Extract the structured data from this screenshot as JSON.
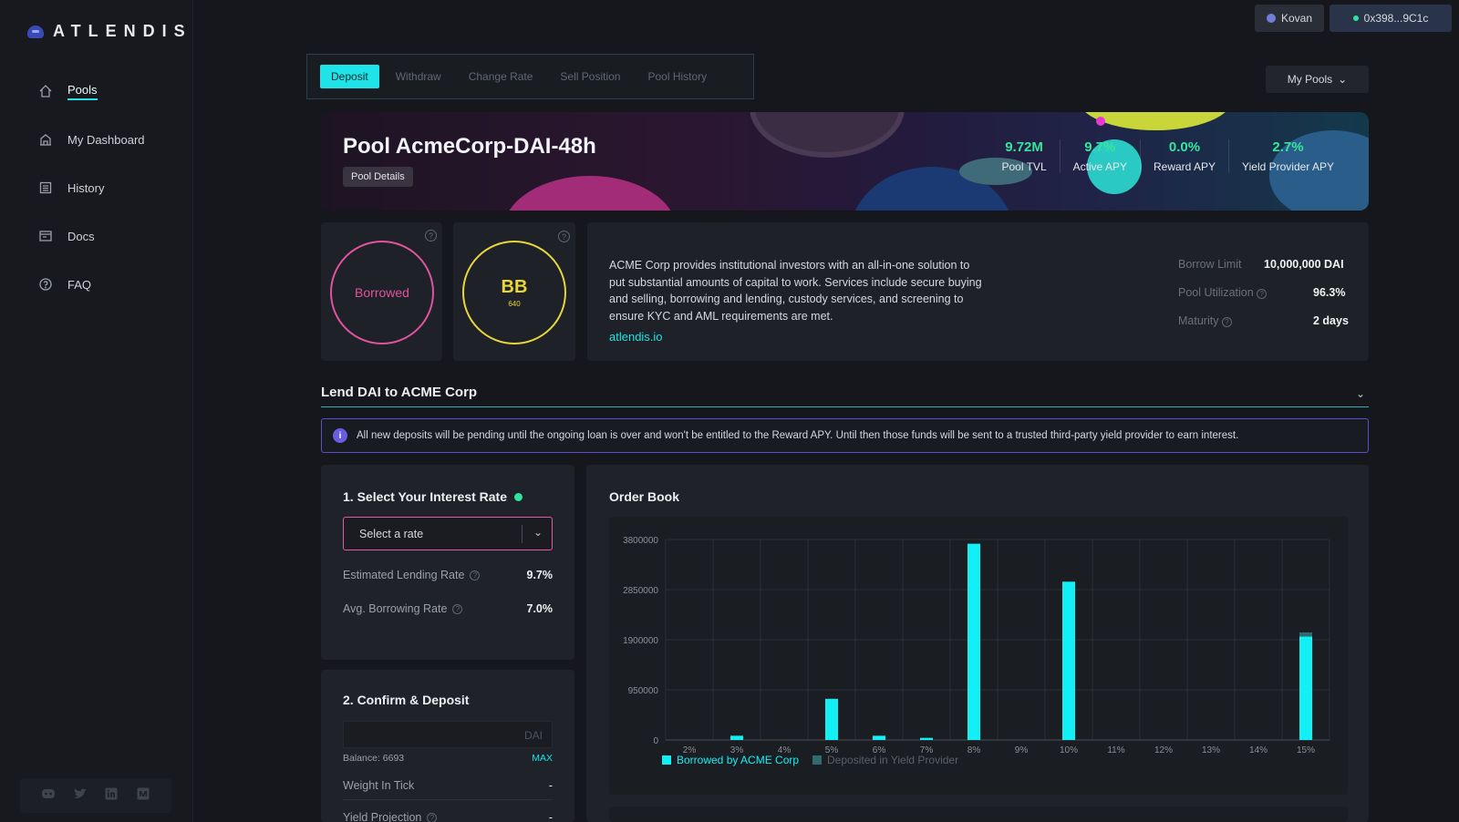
{
  "app": {
    "logo_text": "ATLENDIS"
  },
  "sidebar": {
    "items": [
      {
        "label": "Pools",
        "icon": "home-icon",
        "active": true
      },
      {
        "label": "My Dashboard",
        "icon": "dashboard-icon",
        "active": false
      },
      {
        "label": "History",
        "icon": "history-icon",
        "active": false
      },
      {
        "label": "Docs",
        "icon": "docs-icon",
        "active": false
      },
      {
        "label": "FAQ",
        "icon": "help-icon",
        "active": false
      }
    ],
    "socials": [
      "discord-icon",
      "twitter-icon",
      "linkedin-icon",
      "medium-icon"
    ]
  },
  "topbar": {
    "network": "Kovan",
    "wallet": "0x398...9C1c",
    "my_pools": "My Pools"
  },
  "tabs": [
    "Deposit",
    "Withdraw",
    "Change Rate",
    "Sell Position",
    "Pool History"
  ],
  "pool": {
    "title": "Pool AcmeCorp-DAI-48h",
    "details_label": "Pool Details",
    "stats": [
      {
        "value": "9.72M",
        "label": "Pool TVL"
      },
      {
        "value": "9.7%",
        "label": "Active APY"
      },
      {
        "value": "0.0%",
        "label": "Reward APY"
      },
      {
        "value": "2.7%",
        "label": "Yield Provider APY"
      }
    ]
  },
  "status": {
    "label": "Borrowed",
    "color": "#e0539f"
  },
  "rating": {
    "grade": "BB",
    "score": "640",
    "color": "#e6d63a"
  },
  "description": "ACME Corp provides institutional investors with an all-in-one solution to put substantial amounts of capital to work. Services include secure buying and selling, borrowing and lending, custody services, and screening to ensure KYC and AML requirements are met.",
  "website": "atlendis.io",
  "pool_info": {
    "borrow_limit_label": "Borrow Limit",
    "borrow_limit": "10,000,000 DAI",
    "utilization_label": "Pool Utilization",
    "utilization": "96.3%",
    "maturity_label": "Maturity",
    "maturity": "2 days"
  },
  "lend": {
    "title": "Lend DAI to ACME Corp",
    "notice": "All new deposits will be pending until the ongoing loan is over and won't be entitled to the Reward APY. Until then those funds will be sent to a trusted third-party yield provider to earn interest."
  },
  "rate_panel": {
    "title": "1. Select Your Interest Rate",
    "select_placeholder": "Select a rate",
    "est_label": "Estimated Lending Rate",
    "est_value": "9.7%",
    "avg_label": "Avg. Borrowing Rate",
    "avg_value": "7.0%"
  },
  "deposit_panel": {
    "title": "2. Confirm & Deposit",
    "currency": "DAI",
    "balance": "Balance: 6693",
    "max": "MAX",
    "weight_label": "Weight In Tick",
    "weight_value": "-",
    "yield_label": "Yield Projection",
    "yield_value": "-"
  },
  "order_book": {
    "title": "Order Book"
  },
  "chart_data": {
    "type": "bar",
    "categories": [
      "2%",
      "3%",
      "4%",
      "5%",
      "6%",
      "7%",
      "8%",
      "9%",
      "10%",
      "11%",
      "12%",
      "13%",
      "14%",
      "15%"
    ],
    "series": [
      {
        "name": "Borrowed by ACME Corp",
        "color": "#13f0f5",
        "values": [
          0,
          80000,
          0,
          780000,
          80000,
          40000,
          3720000,
          0,
          3000000,
          0,
          0,
          0,
          0,
          1960000
        ]
      },
      {
        "name": "Deposited in Yield Provider",
        "color": "#2f6b6f",
        "values": [
          0,
          0,
          0,
          0,
          0,
          0,
          0,
          0,
          0,
          0,
          0,
          0,
          0,
          80000
        ]
      }
    ],
    "yticks": [
      "0",
      "950000",
      "1900000",
      "2850000",
      "3800000"
    ],
    "ylim": [
      0,
      3800000
    ],
    "stacked": true,
    "grid": true,
    "legend": "bottom-left"
  }
}
